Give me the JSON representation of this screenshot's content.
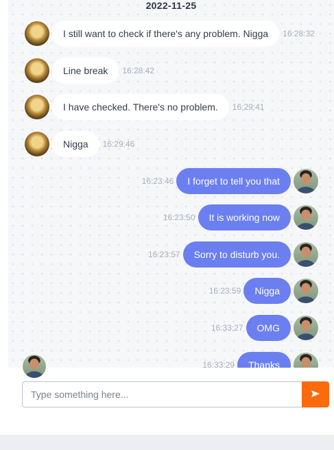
{
  "chat": {
    "date": "2022-11-25",
    "messages": [
      {
        "dir": "in",
        "text": "I still want to check if there's any problem. Nigga",
        "time": "16:28:32"
      },
      {
        "dir": "in",
        "text": "Line break",
        "time": "16:28:42"
      },
      {
        "dir": "in",
        "text": "I have checked. There's no problem.",
        "time": "16:29:41"
      },
      {
        "dir": "in",
        "text": "Nigga",
        "time": "16:29:46"
      },
      {
        "dir": "out",
        "text": "I forget to tell you that",
        "time": "16:23:46"
      },
      {
        "dir": "out",
        "text": "It is working now",
        "time": "16:23:50"
      },
      {
        "dir": "out",
        "text": "Sorry to disturb you.",
        "time": "16:23:57"
      },
      {
        "dir": "out",
        "text": "Nigga",
        "time": "16:23:59"
      },
      {
        "dir": "out",
        "text": "OMG",
        "time": "16:33:27"
      },
      {
        "dir": "out",
        "text": "Thanks",
        "time": "16:33:29"
      }
    ]
  },
  "composer": {
    "placeholder": "Type something here...",
    "value": "",
    "send_icon": "send-icon",
    "send_color": "#fb6a0b"
  },
  "colors": {
    "outgoing_bubble": "#6b7ff0",
    "incoming_bubble": "#ffffff"
  }
}
